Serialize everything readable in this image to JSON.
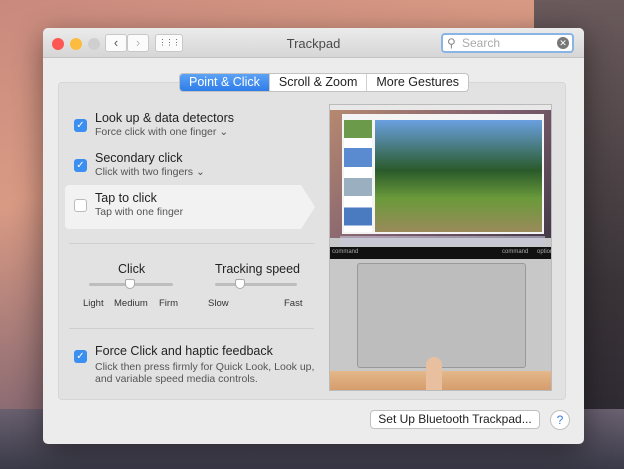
{
  "window": {
    "title": "Trackpad",
    "search_placeholder": "Search"
  },
  "toolbar": {
    "back": "‹",
    "forward": "›",
    "grid": "⋮⋮⋮"
  },
  "tabs": [
    {
      "label": "Point & Click",
      "active": true
    },
    {
      "label": "Scroll & Zoom"
    },
    {
      "label": "More Gestures"
    }
  ],
  "options": [
    {
      "title": "Look up & data detectors",
      "subtitle": "Force click with one finger",
      "checked": true
    },
    {
      "title": "Secondary click",
      "subtitle": "Click with two fingers",
      "checked": true
    },
    {
      "title": "Tap to click",
      "subtitle": "Tap with one finger",
      "checked": false
    }
  ],
  "click_slider": {
    "label": "Click",
    "ticks": [
      "Light",
      "Medium",
      "Firm"
    ],
    "value": "Medium"
  },
  "tracking_slider": {
    "label": "Tracking speed",
    "min_label": "Slow",
    "max_label": "Fast",
    "value_fraction": 0.3
  },
  "force_click": {
    "title": "Force Click and haptic feedback",
    "description_1": "Click then press firmly for Quick Look, Look up,",
    "description_2": "and variable speed media controls.",
    "checked": true
  },
  "preview": {
    "key_left": "command",
    "key_right": "command",
    "key_far": "option"
  },
  "footer": {
    "setup_button": "Set Up Bluetooth Trackpad...",
    "help": "?"
  },
  "icons": {
    "check": "✓",
    "chevron": "⌄",
    "search": "⚲",
    "clear": "✕"
  }
}
